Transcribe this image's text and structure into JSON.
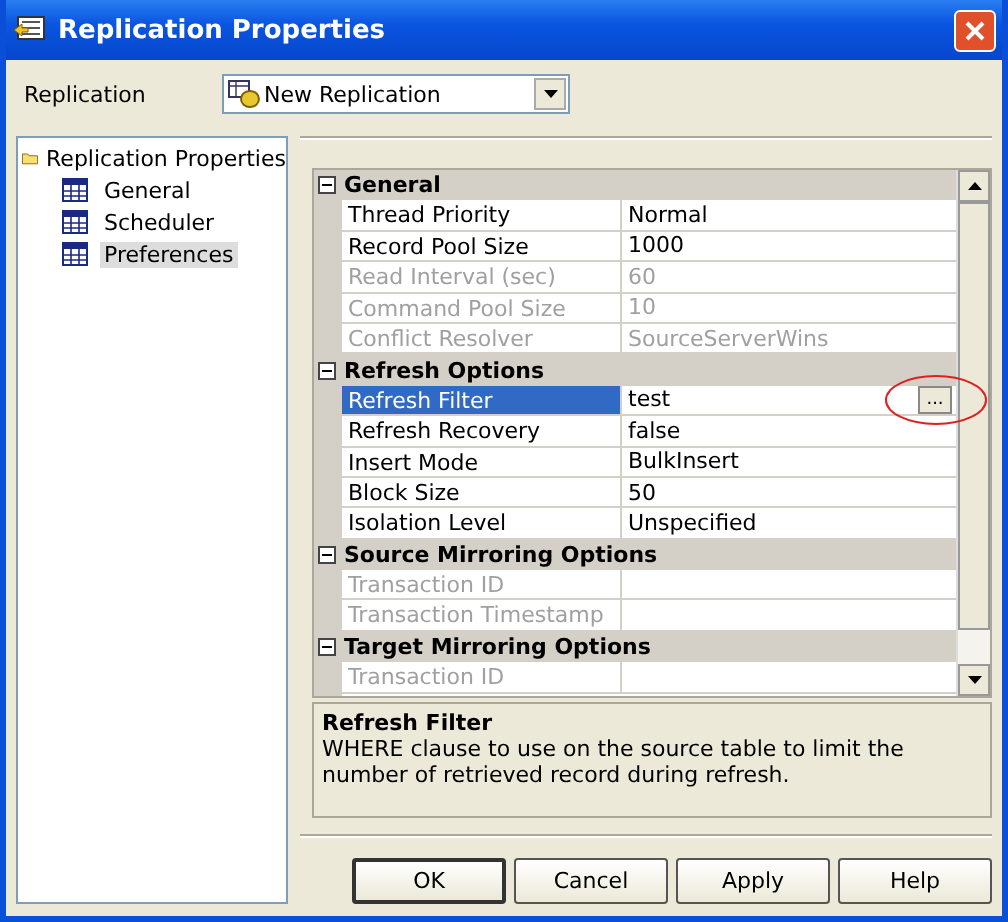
{
  "window": {
    "title": "Replication Properties"
  },
  "replication": {
    "label": "Replication",
    "value": "New Replication"
  },
  "tree": {
    "label": "Replication Properties",
    "children": [
      {
        "label": "General",
        "selected": false
      },
      {
        "label": "Scheduler",
        "selected": false
      },
      {
        "label": "Preferences",
        "selected": true
      }
    ]
  },
  "grid": {
    "rows": [
      {
        "kind": "category",
        "label": "General",
        "expanded": true
      },
      {
        "kind": "property",
        "label": "Thread Priority",
        "value": "Normal",
        "disabled": false,
        "selected": false
      },
      {
        "kind": "property",
        "label": "Record Pool Size",
        "value": "1000",
        "disabled": false,
        "selected": false
      },
      {
        "kind": "property",
        "label": "Read Interval (sec)",
        "value": "60",
        "disabled": true,
        "selected": false
      },
      {
        "kind": "property",
        "label": "Command Pool Size",
        "value": "10",
        "disabled": true,
        "selected": false
      },
      {
        "kind": "property",
        "label": "Conflict Resolver",
        "value": "SourceServerWins",
        "disabled": true,
        "selected": false
      },
      {
        "kind": "category",
        "label": "Refresh Options",
        "expanded": true
      },
      {
        "kind": "property",
        "label": "Refresh Filter",
        "value": "test",
        "disabled": false,
        "selected": true,
        "button": "..."
      },
      {
        "kind": "property",
        "label": "Refresh Recovery",
        "value": "false",
        "disabled": false,
        "selected": false
      },
      {
        "kind": "property",
        "label": "Insert Mode",
        "value": "BulkInsert",
        "disabled": false,
        "selected": false
      },
      {
        "kind": "property",
        "label": "Block Size",
        "value": "50",
        "disabled": false,
        "selected": false
      },
      {
        "kind": "property",
        "label": "Isolation Level",
        "value": "Unspecified",
        "disabled": false,
        "selected": false
      },
      {
        "kind": "category",
        "label": "Source Mirroring Options",
        "expanded": true
      },
      {
        "kind": "property",
        "label": "Transaction ID",
        "disabled": true,
        "selected": false
      },
      {
        "kind": "property",
        "label": "Transaction Timestamp",
        "disabled": true,
        "selected": false
      },
      {
        "kind": "category",
        "label": "Target Mirroring Options",
        "expanded": true
      },
      {
        "kind": "property",
        "label": "Transaction ID",
        "disabled": true,
        "selected": false
      }
    ]
  },
  "description": {
    "title": "Refresh Filter",
    "text": "WHERE clause to use on the source table to limit the number of retrieved record during refresh."
  },
  "buttons": [
    {
      "label": "OK",
      "default": true
    },
    {
      "label": "Cancel",
      "default": false
    },
    {
      "label": "Apply",
      "default": false
    },
    {
      "label": "Help",
      "default": false
    }
  ]
}
